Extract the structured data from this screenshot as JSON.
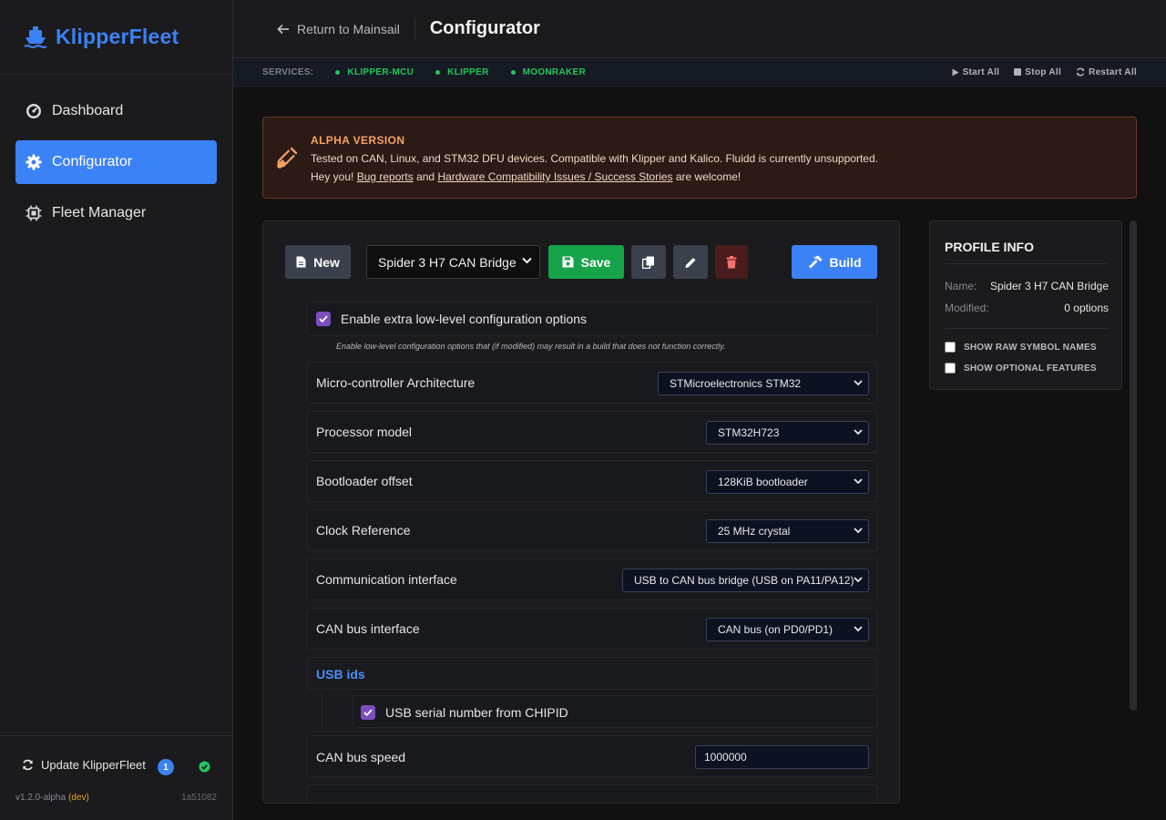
{
  "brand": {
    "name": "KlipperFleet"
  },
  "sidebar": {
    "items": [
      {
        "label": "Dashboard",
        "icon": "gauge-icon",
        "active": false
      },
      {
        "label": "Configurator",
        "icon": "gear-icon",
        "active": true
      },
      {
        "label": "Fleet Manager",
        "icon": "chip-icon",
        "active": false
      }
    ],
    "footer": {
      "update_label": "Update KlipperFleet",
      "update_count": "1",
      "version": "v1.2.0-alpha",
      "channel": "(dev)",
      "commit": "1a51082"
    }
  },
  "header": {
    "back_label": "Return to Mainsail",
    "title": "Configurator"
  },
  "services": {
    "label": "SERVICES:",
    "items": [
      "KLIPPER-MCU",
      "KLIPPER",
      "MOONRAKER"
    ],
    "actions": {
      "start": "Start All",
      "stop": "Stop All",
      "restart": "Restart All"
    }
  },
  "alert": {
    "title": "ALPHA VERSION",
    "line1": "Tested on CAN, Linux, and STM32 DFU devices. Compatible with Klipper and Kalico. Fluidd is currently unsupported.",
    "line2_prefix": "Hey you! ",
    "link1": "Bug reports",
    "line2_mid": " and ",
    "link2": "Hardware Compatibility Issues / Success Stories",
    "line2_suffix": " are welcome!"
  },
  "toolbar": {
    "new_label": "New",
    "profile_selected": "Spider 3 H7 CAN Bridge",
    "save_label": "Save",
    "build_label": "Build"
  },
  "config": {
    "low_level": {
      "label": "Enable extra low-level configuration options",
      "checked": true,
      "hint": "Enable low-level configuration options that (if modified) may result in a build that does not function correctly."
    },
    "options": [
      {
        "label": "Micro-controller Architecture",
        "value": "STMicroelectronics STM32"
      },
      {
        "label": "Processor model",
        "value": "STM32H723"
      },
      {
        "label": "Bootloader offset",
        "value": "128KiB bootloader"
      },
      {
        "label": "Clock Reference",
        "value": "25 MHz crystal"
      },
      {
        "label": "Communication interface",
        "value": "USB to CAN bus bridge (USB on PA11/PA12)"
      },
      {
        "label": "CAN bus interface",
        "value": "CAN bus (on PD0/PD1)"
      }
    ],
    "usb_section": "USB ids",
    "usb_serial": {
      "label": "USB serial number from CHIPID",
      "checked": true
    },
    "can_speed": {
      "label": "CAN bus speed",
      "value": "1000000"
    }
  },
  "profile_info": {
    "title": "PROFILE INFO",
    "name_key": "Name:",
    "name_value": "Spider 3 H7 CAN Bridge",
    "modified_key": "Modified:",
    "modified_value": "0 options",
    "toggle_raw": "SHOW RAW SYMBOL NAMES",
    "toggle_optional": "SHOW OPTIONAL FEATURES"
  },
  "colors": {
    "accent": "#3b82f6",
    "success": "#22c55e",
    "warning": "#f4a261",
    "danger_bg": "#4a1c1c",
    "checkbox": "#7c4dbd"
  }
}
